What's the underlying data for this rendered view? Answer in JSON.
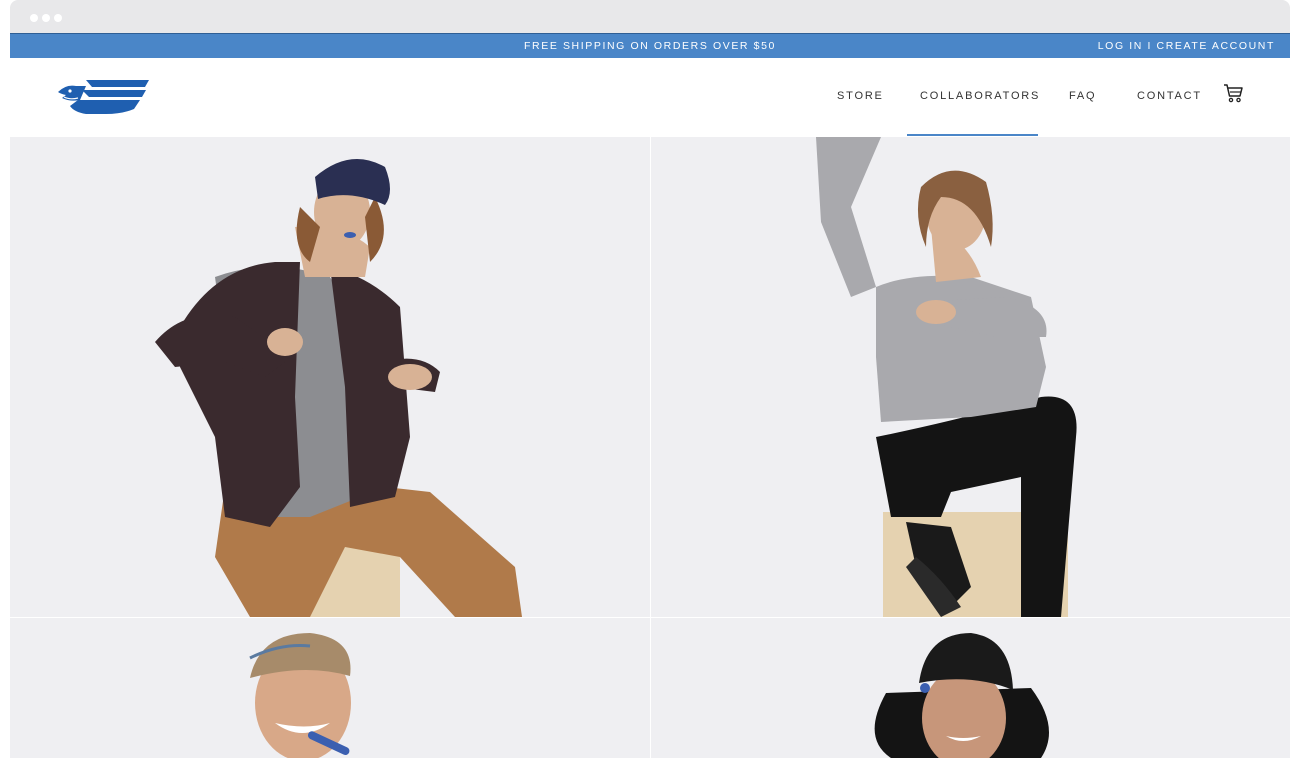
{
  "promo": {
    "text": "FREE SHIPPING ON ORDERS OVER $50"
  },
  "account": {
    "login": "LOG IN",
    "separator": "I",
    "create": "CREATE ACCOUNT"
  },
  "nav": {
    "items": [
      {
        "label": "STORE"
      },
      {
        "label": "COLLABORATORS",
        "active": true
      },
      {
        "label": "FAQ"
      },
      {
        "label": "CONTACT"
      }
    ],
    "cart_icon": "shopping-cart-icon"
  },
  "logo": {
    "icon": "eagle-wing-logo"
  },
  "colors": {
    "brand_blue": "#4a86c8",
    "logo_blue": "#1f5fb0",
    "photo_background": "#eeeef1"
  },
  "gallery": {
    "tiles": [
      {
        "subject": "collaborator-photo-man-blazer"
      },
      {
        "subject": "collaborator-photo-woman-grey-top"
      },
      {
        "subject": "collaborator-photo-man-cap"
      },
      {
        "subject": "collaborator-photo-man-beanie"
      }
    ]
  }
}
